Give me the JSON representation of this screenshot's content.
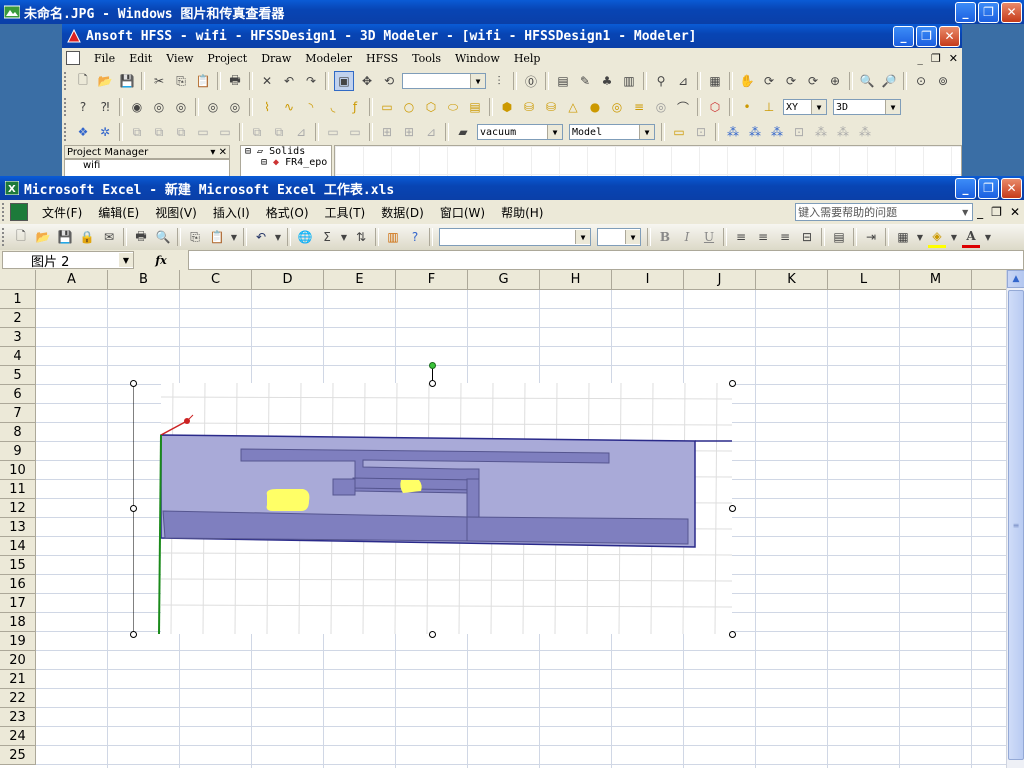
{
  "viewer": {
    "title": "未命名.JPG - Windows 图片和传真查看器"
  },
  "hfss": {
    "title": "Ansoft HFSS  - wifi - HFSSDesign1 - 3D Modeler - [wifi - HFSSDesign1 - Modeler]",
    "menu": [
      "File",
      "Edit",
      "View",
      "Project",
      "Draw",
      "Modeler",
      "HFSS",
      "Tools",
      "Window",
      "Help"
    ],
    "combo_xy": "XY",
    "combo_3d": "3D",
    "combo_material": "vacuum",
    "combo_model": "Model",
    "project_manager": "Project Manager",
    "tree_solids": "Solids",
    "tree_fr4": "FR4_epo",
    "tree_wifi": "wifi"
  },
  "excel": {
    "title": "Microsoft Excel - 新建 Microsoft Excel 工作表.xls",
    "menu": [
      "文件(F)",
      "编辑(E)",
      "视图(V)",
      "插入(I)",
      "格式(O)",
      "工具(T)",
      "数据(D)",
      "窗口(W)",
      "帮助(H)"
    ],
    "help_placeholder": "键入需要帮助的问题",
    "name_box": "图片 2",
    "fx": "fx",
    "font_bold": "B",
    "font_italic": "I",
    "font_underline": "U",
    "font_color_label": "A",
    "columns": [
      "A",
      "B",
      "C",
      "D",
      "E",
      "F",
      "G",
      "H",
      "I",
      "J",
      "K",
      "L",
      "M"
    ],
    "rows": [
      "1",
      "2",
      "3",
      "4",
      "5",
      "6",
      "7",
      "8",
      "9",
      "10",
      "11",
      "12",
      "13",
      "14",
      "15",
      "16",
      "17",
      "18",
      "19",
      "20",
      "21",
      "22",
      "23",
      "24",
      "25"
    ]
  },
  "colors": {
    "xp_blue": "#0a4fc4",
    "substrate": "#a9aad8",
    "trace": "#7f7fbf",
    "patch": "#ffff66",
    "edge": "#2a2a8a"
  }
}
